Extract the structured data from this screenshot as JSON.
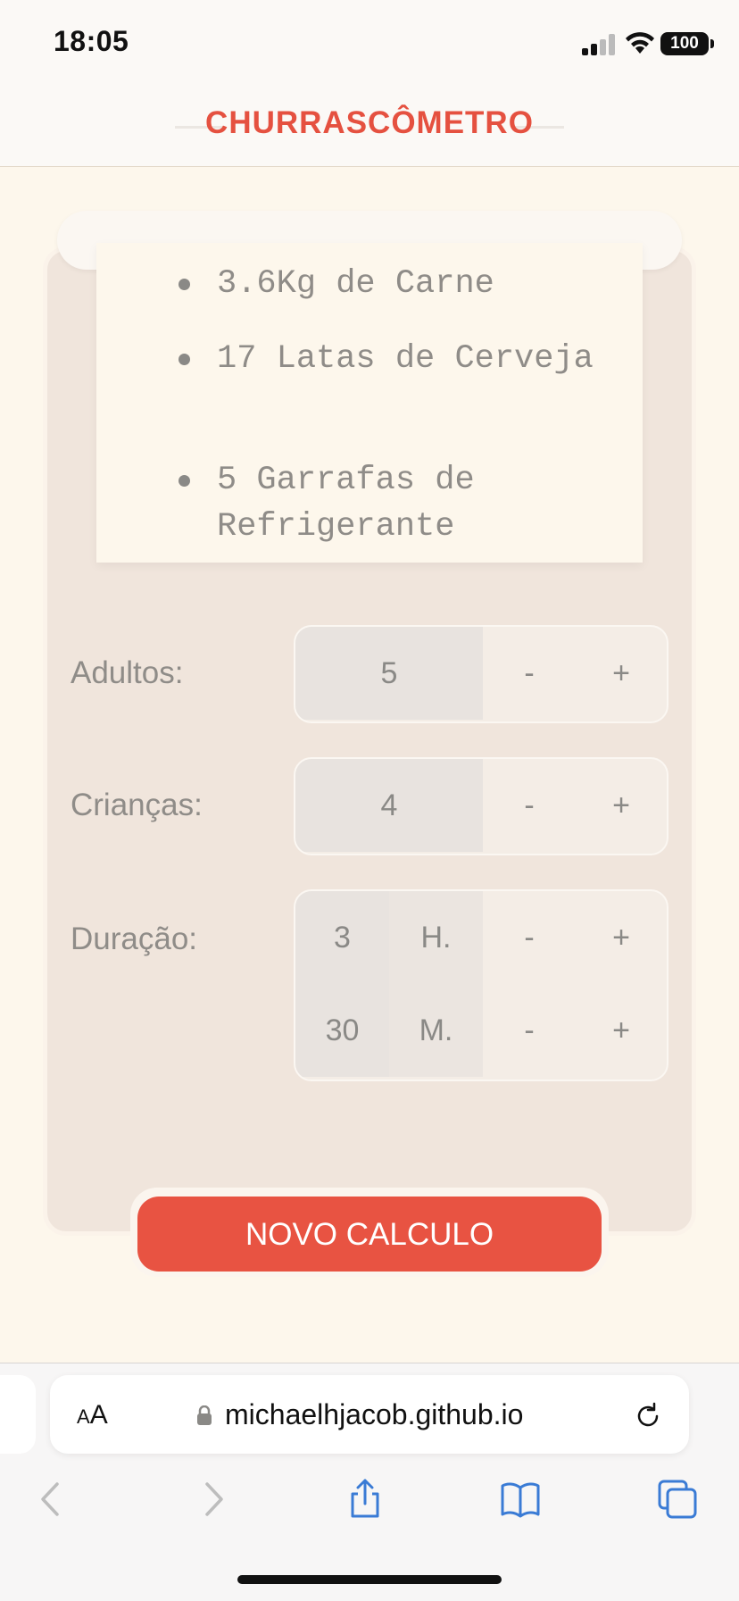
{
  "status_bar": {
    "time": "18:05",
    "battery": "100"
  },
  "header": {
    "title": "CHURRASCÔMETRO"
  },
  "results": [
    "3.6Kg de Carne",
    "17 Latas de Cerveja",
    "5 Garrafas de Refrigerante"
  ],
  "controls": {
    "adults": {
      "label": "Adultos:",
      "value": "5",
      "minus": "-",
      "plus": "+"
    },
    "children": {
      "label": "Crianças:",
      "value": "4",
      "minus": "-",
      "plus": "+"
    },
    "duration": {
      "label": "Duração:",
      "hours": {
        "value": "3",
        "unit": "H.",
        "minus": "-",
        "plus": "+"
      },
      "minutes": {
        "value": "30",
        "unit": "M.",
        "minus": "-",
        "plus": "+"
      }
    }
  },
  "action_button": {
    "label": "NOVO CALCULO"
  },
  "browser": {
    "aa": "AA",
    "url": "michaelhjacob.github.io"
  },
  "colors": {
    "accent": "#e85342",
    "title": "#e55140",
    "card": "#f0e5dc",
    "page": "#fdf7ec"
  }
}
